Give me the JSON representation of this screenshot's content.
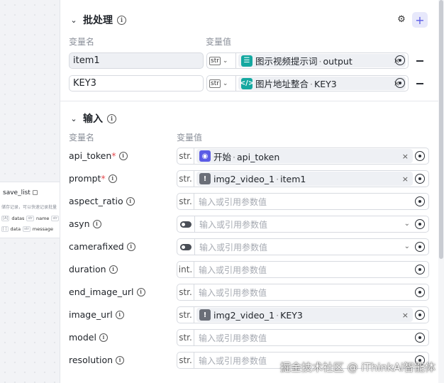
{
  "canvas_node": {
    "title": "save_list",
    "desc": "储存记录，可以快速记录批量",
    "row1": [
      {
        "tag": "[A]",
        "label": "datas"
      },
      {
        "tag": "str",
        "label": "name"
      },
      {
        "tag": "str",
        "label": ""
      }
    ],
    "row2": [
      {
        "tag": "[ ]",
        "label": "data"
      },
      {
        "tag": "str",
        "label": "message"
      }
    ]
  },
  "batch": {
    "title": "批处理",
    "col_name": "变量名",
    "col_value": "变量值",
    "rows": [
      {
        "name": "item1",
        "type": "str",
        "ref_node": "图示视频提示词",
        "ref_field": "output"
      },
      {
        "name": "KEY3",
        "type": "str",
        "ref_node": "图片地址整合",
        "ref_field": "KEY3"
      }
    ]
  },
  "input": {
    "title": "输入",
    "col_name": "变量名",
    "col_value": "变量值",
    "placeholder": "输入或引用参数值",
    "params": [
      {
        "name": "api_token",
        "required": "*",
        "type": "str.",
        "ref_node": "开始",
        "ref_field": "api_token"
      },
      {
        "name": "prompt",
        "required": "*",
        "type": "str.",
        "ref_node": "img2_video_1",
        "ref_field": "item1"
      },
      {
        "name": "aspect_ratio",
        "type": "str."
      },
      {
        "name": "asyn"
      },
      {
        "name": "camerafixed"
      },
      {
        "name": "duration",
        "type": "int."
      },
      {
        "name": "end_image_url",
        "type": "str."
      },
      {
        "name": "image_url",
        "type": "str.",
        "ref_node": "img2_video_1",
        "ref_field": "KEY3"
      },
      {
        "name": "model",
        "type": "str."
      },
      {
        "name": "resolution",
        "type": "str."
      }
    ]
  },
  "watermark": "掘金技术社区 @ iThinkAi智能体",
  "colors": {
    "accent": "#5b5ce6",
    "teal": "#14a8a0",
    "required": "#e5484d"
  }
}
